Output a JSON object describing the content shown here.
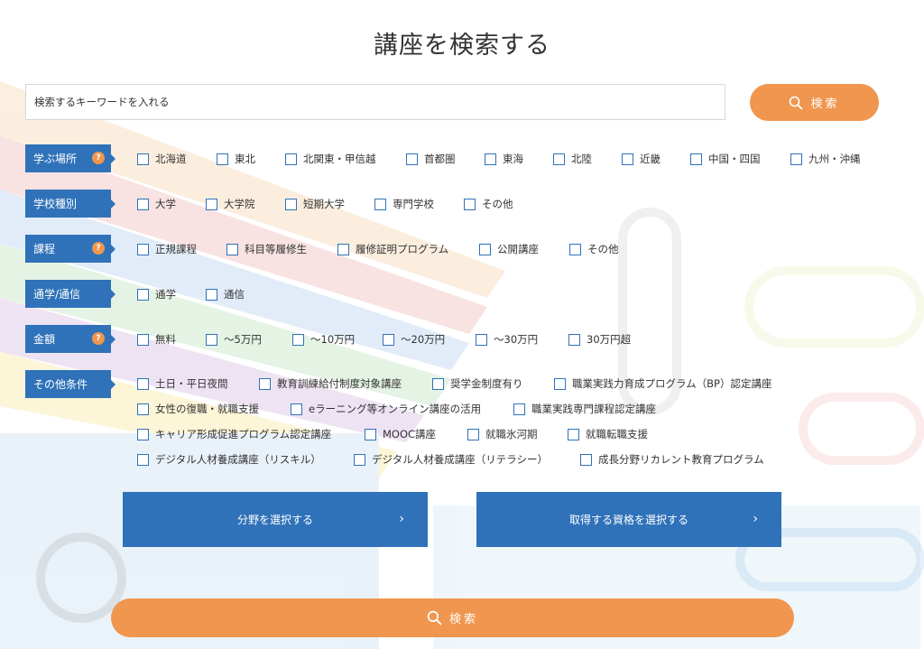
{
  "page_title": "講座を検索する",
  "search": {
    "placeholder": "検索するキーワードを入れる",
    "button_label": "検索"
  },
  "rows": [
    {
      "label": "学ぶ場所",
      "help": true,
      "options": [
        "北海道",
        "東北",
        "北関東・甲信越",
        "首都圏",
        "東海",
        "北陸",
        "近畿",
        "中国・四国",
        "九州・沖縄"
      ]
    },
    {
      "label": "学校種別",
      "help": false,
      "options": [
        "大学",
        "大学院",
        "短期大学",
        "専門学校",
        "その他"
      ]
    },
    {
      "label": "課程",
      "help": true,
      "options": [
        "正規課程",
        "科目等履修生",
        "履修証明プログラム",
        "公開講座",
        "その他"
      ]
    },
    {
      "label": "通学/通信",
      "help": false,
      "options": [
        "通学",
        "通信"
      ]
    },
    {
      "label": "金額",
      "help": true,
      "options": [
        "無料",
        "〜5万円",
        "〜10万円",
        "〜20万円",
        "〜30万円",
        "30万円超"
      ]
    },
    {
      "label": "その他条件",
      "help": false,
      "options": [
        "土日・平日夜間",
        "教育訓練給付制度対象講座",
        "奨学金制度有り",
        "職業実践力育成プログラム（BP）認定講座",
        "女性の復職・就職支援",
        "eラーニング等オンライン講座の活用",
        "職業実践専門課程認定講座",
        "キャリア形成促進プログラム認定講座",
        "MOOC講座",
        "就職氷河期",
        "就職転職支援",
        "デジタル人材養成講座（リスキル）",
        "デジタル人材養成講座（リテラシー）",
        "成長分野リカレント教育プログラム"
      ]
    }
  ],
  "help_mark": "?",
  "select_field_button": "分野を選択する",
  "select_qualification_button": "取得する資格を選択する",
  "chevron": "›",
  "bottom_search_button": "検索",
  "colors": {
    "accent_blue": "#2f72b9",
    "accent_orange": "#f0964e"
  }
}
